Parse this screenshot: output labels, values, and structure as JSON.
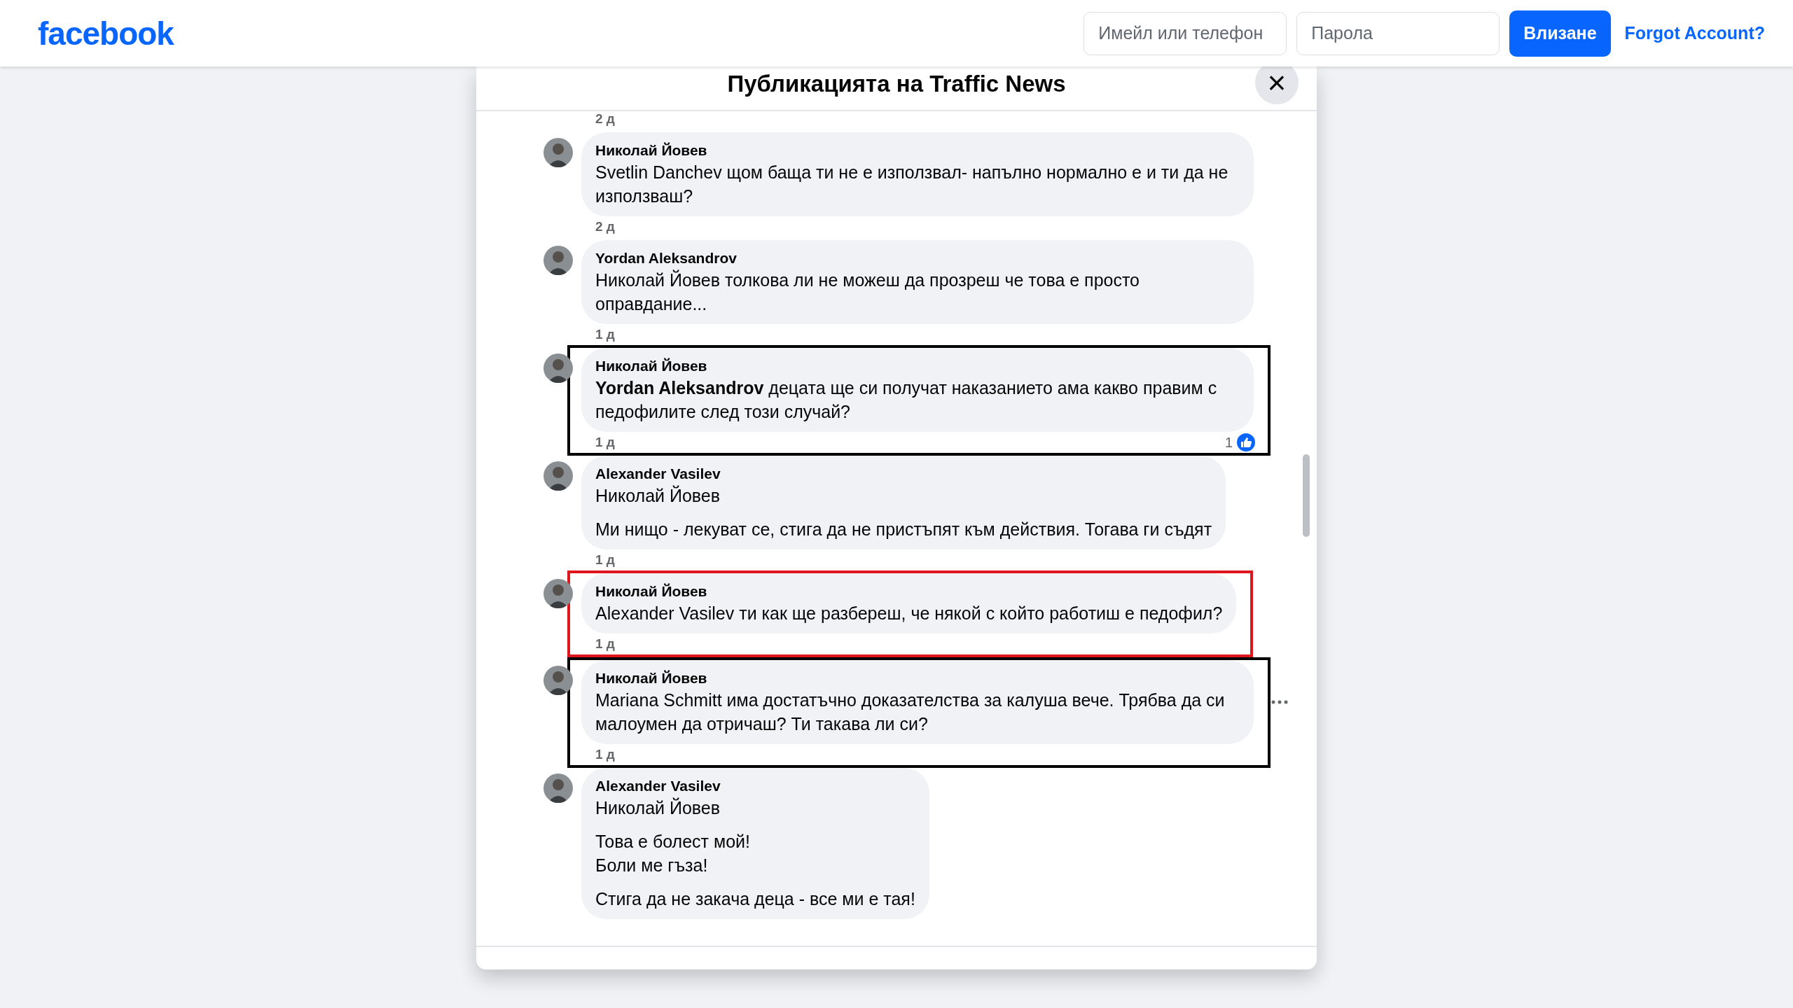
{
  "topbar": {
    "logo": "facebook",
    "email_placeholder": "Имейл или телефон",
    "password_placeholder": "Парола",
    "login_button": "Влизане",
    "forgot_link": "Forgot Account?"
  },
  "dialog": {
    "title": "Публикацията на Traffic News",
    "close": "×",
    "top_time": "2 д",
    "comments": [
      {
        "author": "Николай Йовев",
        "paragraphs": [
          "Svetlin Danchev щом баща ти не е използвал- напълно нормално е и ти да не използваш?"
        ],
        "time": "2 д"
      },
      {
        "author": "Yordan Aleksandrov",
        "paragraphs": [
          "Николай Йовев толкова ли не можеш да прозреш че това е просто оправдание..."
        ],
        "time": "1 д"
      },
      {
        "author": "Николай Йовев",
        "paragraphs": [
          "**Yordan Aleksandrov** децата ще си получат наказанието ама какво правим с педофилите след този случай?"
        ],
        "time": "1 д",
        "likes": "1",
        "color": "#000000"
      },
      {
        "author": "Alexander Vasilev",
        "paragraphs": [
          "Николай Йовев",
          "Ми нищо - лекуват се, стига да не пристъпят към действия. Тогава ги съдят"
        ],
        "time": "1 д"
      },
      {
        "author": "Николай Йовев",
        "paragraphs": [
          "Alexander Vasilev ти как ще разбереш, че някой с който работиш е педофил?"
        ],
        "time": "1 д",
        "color": "#e0161e"
      },
      {
        "author": "Николай Йовев",
        "paragraphs": [
          "Mariana Schmitt има достатъчно доказателства за калуша вече. Трябва да си малоумен да отричаш? Ти такава ли си?"
        ],
        "time": "1 д",
        "color": "#000000",
        "hovered": true
      },
      {
        "author": "Alexander Vasilev",
        "paragraphs": [
          "Николай Йовев",
          "Това е болест мой!\nБоли ме гъза!",
          "Стига да не закача деца - все ми е тая!"
        ]
      }
    ]
  }
}
